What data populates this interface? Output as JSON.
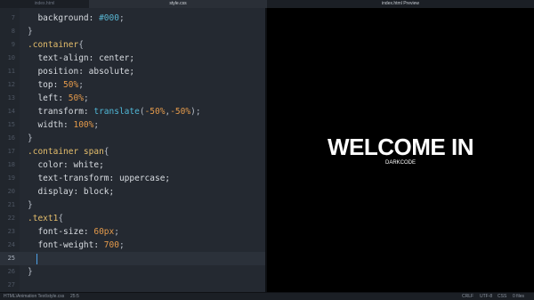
{
  "tabs": {
    "html_tab": "index.html",
    "css_tab": "style.css",
    "preview_tab": "index.html Preview"
  },
  "editor": {
    "lines": [
      {
        "n": "7",
        "tokens": [
          {
            "t": "  background: ",
            "c": "prop"
          },
          {
            "t": "#000",
            "c": "hash"
          },
          {
            "t": ";",
            "c": "punc"
          }
        ]
      },
      {
        "n": "8",
        "tokens": [
          {
            "t": "}",
            "c": "punc"
          }
        ]
      },
      {
        "n": "9",
        "tokens": [
          {
            "t": ".container",
            "c": "sel"
          },
          {
            "t": "{",
            "c": "punc"
          }
        ]
      },
      {
        "n": "10",
        "tokens": [
          {
            "t": "  text-align: center;",
            "c": "prop"
          }
        ]
      },
      {
        "n": "11",
        "tokens": [
          {
            "t": "  position: absolute;",
            "c": "prop"
          }
        ]
      },
      {
        "n": "12",
        "tokens": [
          {
            "t": "  top: ",
            "c": "prop"
          },
          {
            "t": "50%",
            "c": "num"
          },
          {
            "t": ";",
            "c": "punc"
          }
        ]
      },
      {
        "n": "13",
        "tokens": [
          {
            "t": "  left: ",
            "c": "prop"
          },
          {
            "t": "50%",
            "c": "num"
          },
          {
            "t": ";",
            "c": "punc"
          }
        ]
      },
      {
        "n": "14",
        "tokens": [
          {
            "t": "  transform: ",
            "c": "prop"
          },
          {
            "t": "translate",
            "c": "fn"
          },
          {
            "t": "(",
            "c": "punc"
          },
          {
            "t": "-50%",
            "c": "num"
          },
          {
            "t": ",",
            "c": "punc"
          },
          {
            "t": "-50%",
            "c": "num"
          },
          {
            "t": ");",
            "c": "punc"
          }
        ]
      },
      {
        "n": "15",
        "tokens": [
          {
            "t": "  width: ",
            "c": "prop"
          },
          {
            "t": "100%",
            "c": "num"
          },
          {
            "t": ";",
            "c": "punc"
          }
        ]
      },
      {
        "n": "16",
        "tokens": [
          {
            "t": "}",
            "c": "punc"
          }
        ]
      },
      {
        "n": "17",
        "tokens": [
          {
            "t": ".container span",
            "c": "sel"
          },
          {
            "t": "{",
            "c": "punc"
          }
        ]
      },
      {
        "n": "18",
        "tokens": [
          {
            "t": "  color: white;",
            "c": "prop"
          }
        ]
      },
      {
        "n": "19",
        "tokens": [
          {
            "t": "  text-transform: uppercase;",
            "c": "prop"
          }
        ]
      },
      {
        "n": "20",
        "tokens": [
          {
            "t": "  display: block;",
            "c": "prop"
          }
        ]
      },
      {
        "n": "21",
        "tokens": [
          {
            "t": "}",
            "c": "punc"
          }
        ]
      },
      {
        "n": "22",
        "tokens": [
          {
            "t": ".text1",
            "c": "sel"
          },
          {
            "t": "{",
            "c": "punc"
          }
        ]
      },
      {
        "n": "23",
        "tokens": [
          {
            "t": "  font-size: ",
            "c": "prop"
          },
          {
            "t": "60px",
            "c": "num"
          },
          {
            "t": ";",
            "c": "punc"
          }
        ]
      },
      {
        "n": "24",
        "tokens": [
          {
            "t": "  font-weight: ",
            "c": "prop"
          },
          {
            "t": "700",
            "c": "num"
          },
          {
            "t": ";",
            "c": "punc"
          }
        ]
      },
      {
        "n": "25",
        "tokens": [],
        "current": true
      },
      {
        "n": "26",
        "tokens": [
          {
            "t": "}",
            "c": "punc"
          }
        ]
      },
      {
        "n": "27",
        "tokens": []
      }
    ]
  },
  "preview": {
    "title": "Welcome in",
    "subtitle": "Darkcode"
  },
  "statusbar": {
    "path": "HTML\\Animation Text\\style.css",
    "position": "25:5",
    "line_ending": "CRLF",
    "encoding": "UTF-8",
    "language": "CSS",
    "files": "0 files"
  },
  "colors": {
    "editor_bg": "#242931",
    "preview_bg": "#000000",
    "selector": "#e5be6c",
    "number": "#e49a4b",
    "function": "#50b7d6",
    "cursor": "#4ea2e8"
  }
}
